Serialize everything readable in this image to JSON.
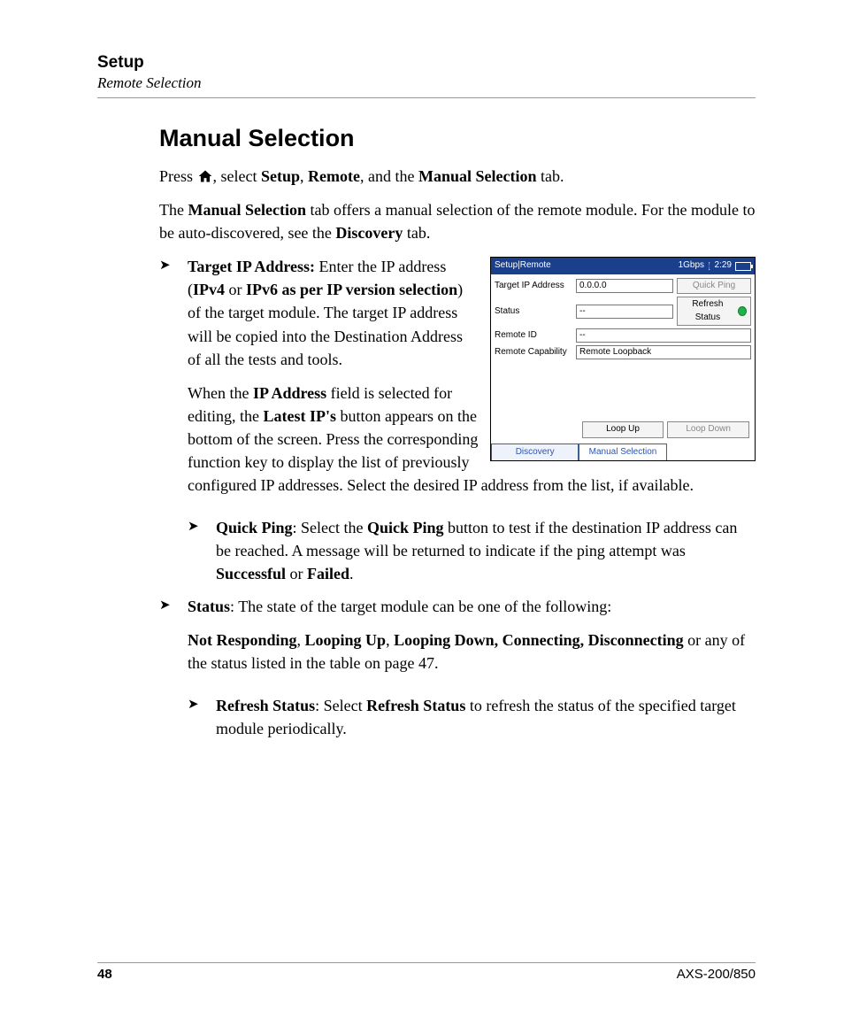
{
  "header": {
    "title": "Setup",
    "subtitle": "Remote Selection"
  },
  "section_title": "Manual Selection",
  "intro": {
    "line1_pre": "Press ",
    "line1_mid1": ", select ",
    "line1_b1": "Setup",
    "line1_sep1": ", ",
    "line1_b2": "Remote",
    "line1_mid2": ", and the ",
    "line1_b3": "Manual Selection",
    "line1_post": " tab.",
    "line2_pre": "The ",
    "line2_b1": "Manual Selection",
    "line2_mid": " tab offers a manual selection of the remote module. For the module to be auto-discovered, see the ",
    "line2_b2": "Discovery",
    "line2_post": " tab."
  },
  "bullets": {
    "target_ip": {
      "b1": "Target IP Address:",
      "t1": " Enter the IP address (",
      "b2": "IPv4",
      "t2": " or ",
      "b3": "IPv6 as per IP version selection",
      "t3": ") of the target module. The target IP address will be copied into the Destination Address of all the tests and tools.",
      "p2_t1": "When the ",
      "p2_b1": "IP Address",
      "p2_t2": " field is selected for editing, the ",
      "p2_b2": "Latest IP's",
      "p2_t3": " button appears on the bottom of the screen. Press the corresponding function key to display the list of previously configured IP addresses. Select the desired IP address from the list, if available."
    },
    "quick_ping": {
      "b1": "Quick Ping",
      "t1": ": Select the ",
      "b2": "Quick Ping",
      "t2": " button to test if the destination IP address can be reached. A message will be returned to indicate if the ping attempt was ",
      "b3": "Successful",
      "t3": " or ",
      "b4": "Failed",
      "t4": "."
    },
    "status": {
      "b1": "Status",
      "t1": ": The state of the target module can be one of the following:",
      "p2_b1": "Not Responding",
      "p2_s1": ", ",
      "p2_b2": "Looping Up",
      "p2_s2": ", ",
      "p2_b3": "Looping Down, Connecting, Disconnecting",
      "p2_t": " or any of the status listed in the table on page 47."
    },
    "refresh": {
      "b1": "Refresh Status",
      "t1": ": Select ",
      "b2": "Refresh Status",
      "t2": " to refresh the status of the specified target module periodically."
    }
  },
  "screenshot": {
    "breadcrumb": "Setup|Remote",
    "rate": "1Gbps",
    "time": "2:29",
    "rows": {
      "target_ip_label": "Target IP Address",
      "target_ip_value": "0.0.0.0",
      "quick_ping_btn": "Quick Ping",
      "status_label": "Status",
      "status_value": "--",
      "refresh_btn": "Refresh Status",
      "remote_id_label": "Remote ID",
      "remote_id_value": "--",
      "remote_cap_label": "Remote Capability",
      "remote_cap_value": "Remote Loopback"
    },
    "buttons": {
      "loop_up": "Loop Up",
      "loop_down": "Loop Down"
    },
    "tabs": {
      "discovery": "Discovery",
      "manual": "Manual Selection"
    }
  },
  "footer": {
    "page": "48",
    "model": "AXS-200/850"
  }
}
